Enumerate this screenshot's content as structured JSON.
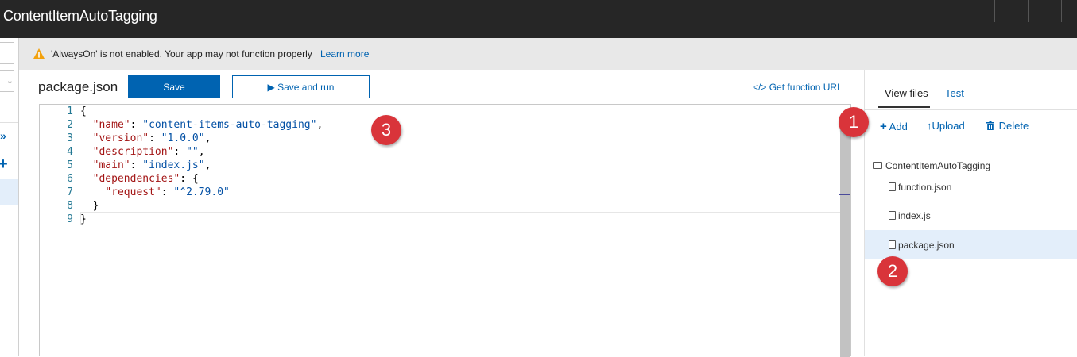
{
  "app": {
    "title": "ContentItemAutoTagging"
  },
  "warning": {
    "message": "'AlwaysOn' is not enabled. Your app may not function properly",
    "link": "Learn more",
    "icon": "warning-triangle-icon",
    "color": "#f2a10d"
  },
  "editor_toolbar": {
    "filename": "package.json",
    "save_label": "Save",
    "save_run_label": "Save and run",
    "save_run_icon": "▶",
    "get_url_label": "Get function URL",
    "get_url_icon": "</>"
  },
  "editor": {
    "line_numbers": [
      "1",
      "2",
      "3",
      "4",
      "5",
      "6",
      "7",
      "8",
      "9"
    ],
    "lines": [
      {
        "indent": "",
        "key": "",
        "sep": "",
        "value": "",
        "trail": "{"
      },
      {
        "indent": "  ",
        "key": "\"name\"",
        "sep": ": ",
        "value": "\"content-items-auto-tagging\"",
        "trail": ","
      },
      {
        "indent": "  ",
        "key": "\"version\"",
        "sep": ": ",
        "value": "\"1.0.0\"",
        "trail": ","
      },
      {
        "indent": "  ",
        "key": "\"description\"",
        "sep": ": ",
        "value": "\"\"",
        "trail": ","
      },
      {
        "indent": "  ",
        "key": "\"main\"",
        "sep": ": ",
        "value": "\"index.js\"",
        "trail": ","
      },
      {
        "indent": "  ",
        "key": "\"dependencies\"",
        "sep": ": ",
        "value": "",
        "trail": "{"
      },
      {
        "indent": "    ",
        "key": "\"request\"",
        "sep": ": ",
        "value": "\"^2.79.0\"",
        "trail": ""
      },
      {
        "indent": "  ",
        "key": "",
        "sep": "",
        "value": "",
        "trail": "}"
      },
      {
        "indent": "",
        "key": "",
        "sep": "",
        "value": "",
        "trail": "}"
      }
    ],
    "key_color": "#a31515",
    "string_color": "#0451a5"
  },
  "panel": {
    "tabs": [
      "View files",
      "Test"
    ],
    "actions": {
      "add": "Add",
      "upload": "Upload",
      "delete": "Delete"
    },
    "folder": "ContentItemAutoTagging",
    "files": [
      "function.json",
      "index.js",
      "package.json"
    ],
    "selected_file": "package.json"
  },
  "callouts": [
    "1",
    "2",
    "3"
  ],
  "colors": {
    "accent": "#0063b1",
    "titlebar": "#262626",
    "callout": "#d9343a"
  }
}
